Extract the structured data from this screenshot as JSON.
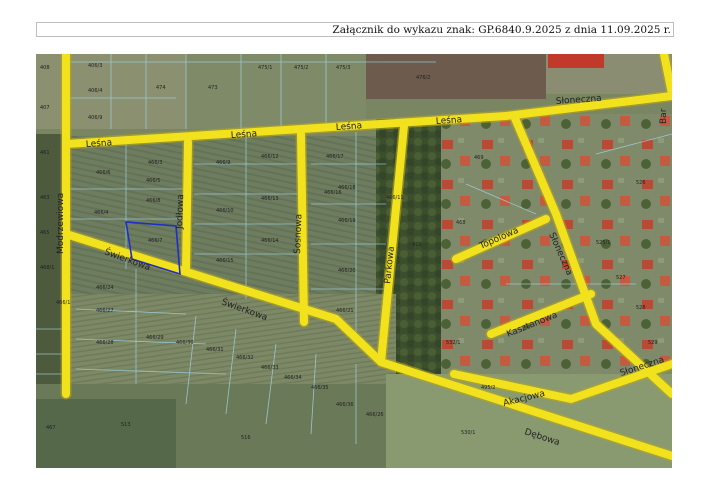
{
  "header": {
    "text": "Załącznik do wykazu znak: GP.6840.9.2025 z dnia 11.09.2025 r."
  },
  "map": {
    "colors": {
      "road": "#f2e21e",
      "road_edge": "#b8a818",
      "field": "#6f7d62",
      "parcel_line": "#9fd2de",
      "highlight": "#1e2fc8"
    },
    "street_labels": {
      "lesna_1": "Leśna",
      "lesna_2": "Leśna",
      "lesna_3": "Leśna",
      "lesna_4": "Leśna",
      "sloneczna_top": "Słoneczna",
      "modrzewiowa": "Modrzewiowa",
      "jodlowa": "Jodłowa",
      "sosnowa": "Sosnowa",
      "parkowa": "Parkowa",
      "swierkowa_1": "Świerkowa",
      "swierkowa_2": "Świerkowa",
      "topolowa": "Topolowa",
      "sloneczna_mid": "Słoneczna",
      "kasztanowa": "Kasztanowa",
      "akacjowa": "Akacjowa",
      "debowa": "Dębowa",
      "sloneczna_right": "Słoneczna",
      "bar_edge": "Bar"
    },
    "parcel_labels": {
      "p1": "406/3",
      "p2": "406/4",
      "p3": "406/9",
      "p4": "474",
      "p5": "473",
      "p6": "475/1",
      "p7": "475/2",
      "p8": "475/3",
      "p9": "476/2",
      "p10": "408",
      "p11": "407",
      "p12": "461",
      "p13": "463",
      "p14": "465",
      "p15": "466/3",
      "p16": "466/7",
      "p17": "466/6",
      "p18": "466/8",
      "p19": "466/9",
      "p20": "466/10",
      "p21": "466/12",
      "p22": "466/13",
      "p23": "466/14",
      "p24": "466/15",
      "p25": "466/17",
      "p26": "466/16",
      "p27": "466/18",
      "p28": "466/19",
      "p29": "466/20",
      "p30": "466/21",
      "p31": "466/24",
      "p32": "466/27",
      "p33": "466/28",
      "p34": "466/29",
      "p35": "466/30",
      "p36": "466/31",
      "p37": "466/32",
      "p38": "466/33",
      "p39": "466/34",
      "p40": "466/35",
      "p41": "466/36",
      "p42": "466/5",
      "p43": "466/4",
      "p44": "466/1",
      "p45": "466/11",
      "p46": "470",
      "p47": "469",
      "p48": "468",
      "p49": "513",
      "p50": "516",
      "p51": "530/1",
      "p52": "532/1",
      "p53": "466/26",
      "p54": "495/2",
      "p55": "467",
      "p56": "468/1",
      "p57": "525/1",
      "p58": "526",
      "p59": "527",
      "p60": "528",
      "p61": "529"
    }
  }
}
